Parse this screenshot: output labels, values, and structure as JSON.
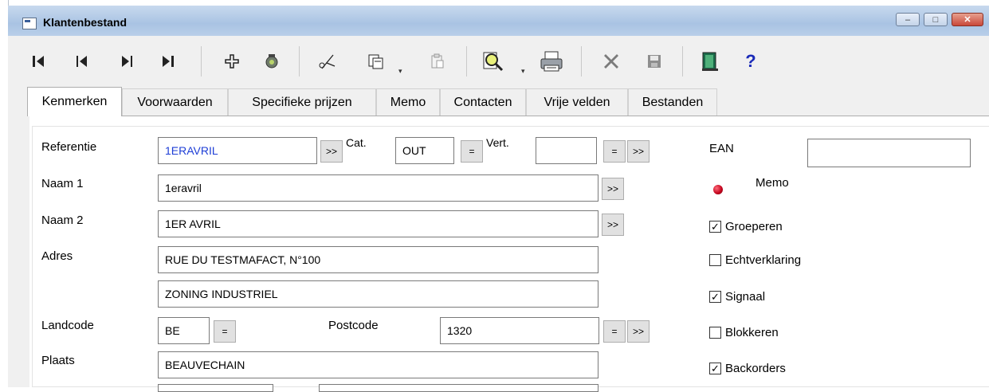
{
  "window": {
    "title": "Klantenbestand",
    "controls": {
      "minimize": "–",
      "maximize": "□",
      "close": "✕"
    }
  },
  "toolbar": {
    "icons": {
      "first": "⏮-icon",
      "prev": "prev-icon",
      "next": "next-icon",
      "last": "last-icon",
      "add": "add-icon",
      "recycle": "recycle-icon",
      "cut": "cut-icon",
      "copy": "copy-icon",
      "paste": "paste-icon",
      "search": "search-icon",
      "print": "print-icon",
      "delete": "delete-icon",
      "save": "save-icon",
      "exit": "exit-icon",
      "help": "help-icon"
    },
    "glyphs": {
      "first": "◀|",
      "prev": "◀",
      "next": "▶",
      "last": "|▶",
      "add": "+",
      "recycle": "♻",
      "cut": "✂",
      "copy": "⧉",
      "paste": "📋",
      "search": "🔍",
      "print": "🖨",
      "delete": "✖",
      "save": "💾",
      "exit": "🚪",
      "help": "?",
      "dropdown": "▾"
    }
  },
  "tabs": [
    "Kenmerken",
    "Voorwaarden",
    "Specifieke prijzen",
    "Memo",
    "Contacten",
    "Vrije velden",
    "Bestanden"
  ],
  "form": {
    "referentie": {
      "label": "Referentie",
      "value": "1ERAVRIL"
    },
    "cat": {
      "label": "Cat.",
      "value": "OUT"
    },
    "vert": {
      "label": "Vert.",
      "value": ""
    },
    "naam1": {
      "label": "Naam 1",
      "value": "1eravril"
    },
    "naam2": {
      "label": "Naam 2",
      "value": "1ER AVRIL"
    },
    "adres": {
      "label": "Adres",
      "line1": "RUE DU TESTMAFACT, N°100",
      "line2": "ZONING INDUSTRIEL"
    },
    "landcode": {
      "label": "Landcode",
      "value": "BE"
    },
    "postcode": {
      "label": "Postcode",
      "value": "1320"
    },
    "plaats": {
      "label": "Plaats",
      "value": "BEAUVECHAIN"
    },
    "buttons": {
      "more": ">>",
      "equals": "="
    }
  },
  "side": {
    "ean": {
      "label": "EAN",
      "value": ""
    },
    "memo": {
      "label": "Memo"
    },
    "checkboxes": [
      {
        "label": "Groeperen",
        "checked": true
      },
      {
        "label": "Echtverklaring",
        "checked": false
      },
      {
        "label": "Signaal",
        "checked": true
      },
      {
        "label": "Blokkeren",
        "checked": false
      },
      {
        "label": "Backorders",
        "checked": true
      }
    ],
    "check_glyph": "✓"
  },
  "colors": {
    "accent_text": "#1e3ed6",
    "memo_dot": "#c1001a"
  }
}
